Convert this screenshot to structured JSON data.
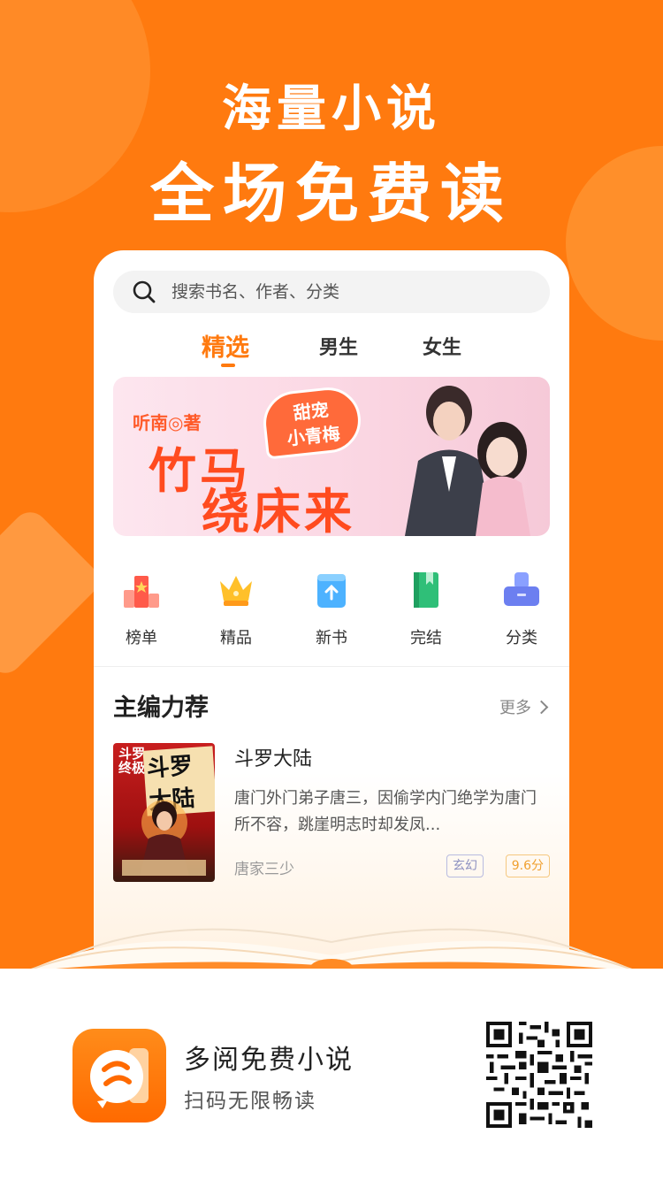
{
  "promo": {
    "headline_1": "海量小说",
    "headline_2": "全场免费读"
  },
  "search": {
    "placeholder": "搜索书名、作者、分类"
  },
  "tabs": [
    {
      "label": "精选",
      "active": true
    },
    {
      "label": "男生",
      "active": false
    },
    {
      "label": "女生",
      "active": false
    }
  ],
  "banner": {
    "author": "听南◎著",
    "tag_line1": "甜宠",
    "tag_line2": "小青梅",
    "title_line1": "竹马",
    "title_line2": "绕床来"
  },
  "categories": [
    {
      "label": "榜单",
      "icon": "ranking-icon"
    },
    {
      "label": "精品",
      "icon": "crown-icon"
    },
    {
      "label": "新书",
      "icon": "new-book-icon"
    },
    {
      "label": "完结",
      "icon": "finished-book-icon"
    },
    {
      "label": "分类",
      "icon": "category-icon"
    }
  ],
  "section": {
    "title": "主编力荐",
    "more_label": "更多"
  },
  "book": {
    "cover_text_a": "斗罗\n终极",
    "cover_text_b": "斗罗大陆",
    "title": "斗罗大陆",
    "description": "唐门外门弟子唐三，因偷学内门绝学为唐门所不容，跳崖明志时却发凤...",
    "author": "唐家三少",
    "genre": "玄幻",
    "score": "9.6分"
  },
  "footer": {
    "app_name": "多阅免费小说",
    "slogan": "扫码无限畅读"
  },
  "colors": {
    "brand_orange": "#ff7a0f",
    "text_dark": "#222222"
  }
}
